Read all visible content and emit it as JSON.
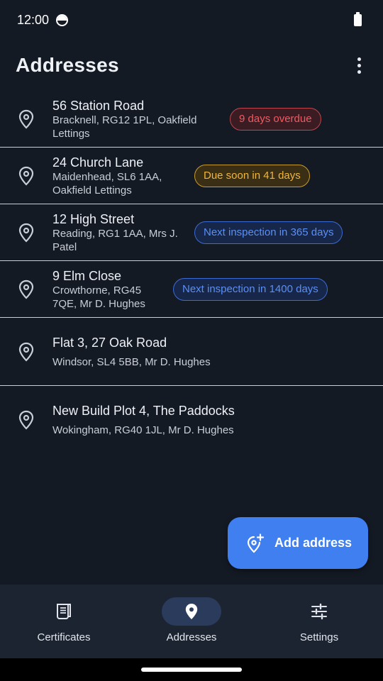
{
  "status_bar": {
    "time": "12:00"
  },
  "header": {
    "title": "Addresses"
  },
  "addresses": [
    {
      "line1": "56 Station Road",
      "line2": "Bracknell, RG12 1PL, Oakfield Lettings",
      "badge": "9 days overdue",
      "status": "overdue"
    },
    {
      "line1": "24 Church Lane",
      "line2": "Maidenhead, SL6 1AA, Oakfield Lettings",
      "badge": "Due soon in 41 days",
      "status": "soon"
    },
    {
      "line1": "12 High Street",
      "line2": "Reading, RG1 1AA, Mrs J. Patel",
      "badge": "Next inspection in 365 days",
      "status": "next"
    },
    {
      "line1": "9 Elm Close",
      "line2": "Crowthorne, RG45 7QE, Mr D. Hughes",
      "badge": "Next inspection in 1400 days",
      "status": "next"
    },
    {
      "line1": "Flat 3, 27 Oak Road",
      "line2": "Windsor, SL4 5BB, Mr D. Hughes"
    },
    {
      "line1": "New Build Plot 4, The Paddocks",
      "line2": "Wokingham, RG40 1JL, Mr D. Hughes"
    }
  ],
  "fab": {
    "label": "Add address",
    "icon": "add-location-icon"
  },
  "bottom_nav": {
    "items": [
      {
        "label": "Certificates",
        "icon": "certificate-icon",
        "active": false
      },
      {
        "label": "Addresses",
        "icon": "location-pin-icon",
        "active": true
      },
      {
        "label": "Settings",
        "icon": "sliders-icon",
        "active": false
      }
    ]
  },
  "colors": {
    "background": "#141a24",
    "accent": "#3f7ff0",
    "overdue": "#ef5a62",
    "due_soon": "#f0b53c",
    "next_inspection": "#5b8ff5",
    "nav_background": "#1c2432"
  }
}
